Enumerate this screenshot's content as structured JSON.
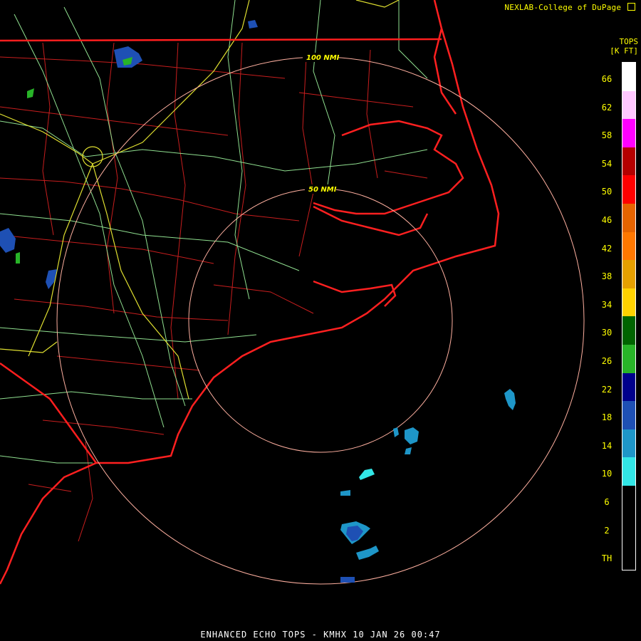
{
  "credit": "NEXLAB-College of DuPage",
  "logo": "cod-logo-icon",
  "legend": {
    "title_line1": "TOPS",
    "title_line2": "[K FT]",
    "labels": [
      "66",
      "62",
      "58",
      "54",
      "50",
      "46",
      "42",
      "38",
      "34",
      "30",
      "26",
      "22",
      "18",
      "14",
      "10",
      "6",
      "2",
      "TH"
    ],
    "colors": [
      "#ffffff",
      "#ffc8ff",
      "#ff00ff",
      "#b40000",
      "#ff0000",
      "#e66400",
      "#ff7800",
      "#e6a000",
      "#ffd200",
      "#006400",
      "#28b428",
      "#00008c",
      "#1e50b4",
      "#1e96c8",
      "#32e6e6",
      "#000000"
    ]
  },
  "rings": [
    {
      "label": "100 NMI"
    },
    {
      "label": "50 NMI"
    }
  ],
  "footer": "ENHANCED ECHO TOPS - KMHX 10 JAN 26 00:47",
  "colors": {
    "coast": "#ff2020",
    "county": "#c81e1e",
    "highway": "#90e090",
    "interstate": "#e0e030",
    "ring": "#ffb0a0",
    "echo_low": "#1e96c8",
    "echo_mid": "#1e50b4"
  }
}
